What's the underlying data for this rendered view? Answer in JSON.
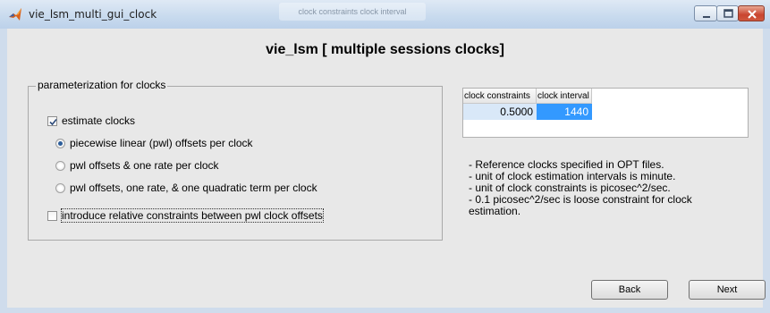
{
  "window": {
    "title": "vie_lsm_multi_gui_clock",
    "ghost_text": "clock constraints clock interval",
    "controls": [
      "minimize-icon",
      "maximize-icon",
      "close-icon"
    ]
  },
  "heading": "vie_lsm [ multiple sessions clocks]",
  "panel": {
    "title": "parameterization for clocks",
    "estimate_clocks": {
      "label": "estimate clocks",
      "checked": true
    },
    "options": [
      {
        "label": "piecewise linear (pwl) offsets per clock",
        "selected": true
      },
      {
        "label": "pwl offsets & one rate per clock",
        "selected": false
      },
      {
        "label": "pwl offsets, one rate, & one quadratic term per clock",
        "selected": false
      }
    ],
    "relative_constraints": {
      "label": "introduce relative constraints between pwl clock offsets",
      "checked": false
    }
  },
  "table": {
    "columns": [
      "clock constraints",
      "clock interval"
    ],
    "rows": [
      [
        "0.5000",
        "1440"
      ]
    ]
  },
  "notes": [
    "- Reference clocks specified in OPT files.",
    "- unit of clock estimation intervals is minute.",
    "- unit of clock constraints is picosec^2/sec.",
    "- 0.1 picosec^2/sec is loose constraint for clock",
    "estimation."
  ],
  "buttons": {
    "back": "Back",
    "next": "Next"
  },
  "colors": {
    "selected_cell": "#3399ff",
    "active_cell": "#d9e8f8",
    "title_bar": "#c9dbee"
  }
}
